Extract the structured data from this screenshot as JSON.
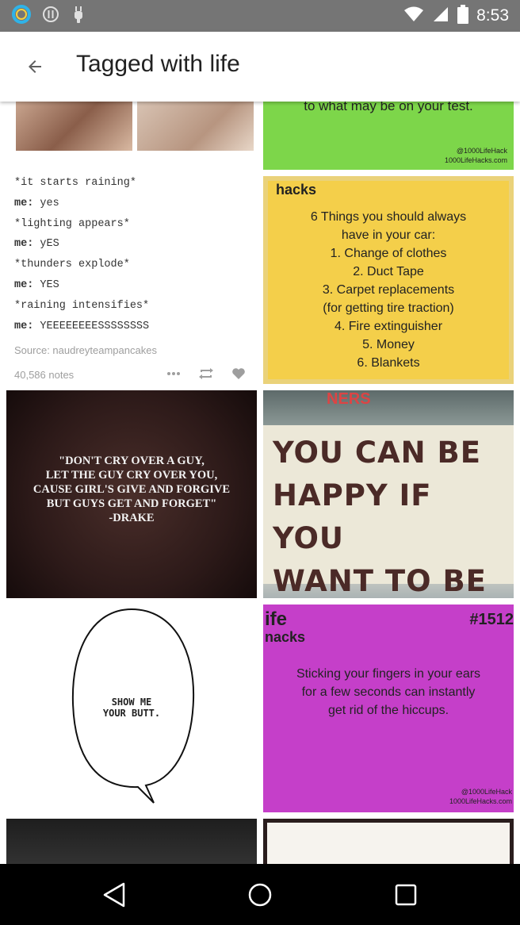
{
  "status_bar": {
    "time": "8:53",
    "left_icons": [
      "circle-app-icon",
      "alert-icon",
      "android-icon"
    ],
    "right_icons": [
      "wifi-icon",
      "signal-icon",
      "battery-icon"
    ]
  },
  "app_bar": {
    "title": "Tagged with life"
  },
  "tiles": {
    "green_lifehack": {
      "caption": "to what may be on your test.",
      "credit_1": "@1000LifeHack",
      "credit_2": "1000LifeHacks.com"
    },
    "text_post": {
      "lines": [
        {
          "prefix": "",
          "text": "*it starts raining*"
        },
        {
          "prefix": "me:",
          "text": " yes"
        },
        {
          "prefix": "",
          "text": "*lighting appears*"
        },
        {
          "prefix": "me:",
          "text": " yES"
        },
        {
          "prefix": "",
          "text": "*thunders explode*"
        },
        {
          "prefix": "me:",
          "text": " YES"
        },
        {
          "prefix": "",
          "text": "*raining intensifies*"
        },
        {
          "prefix": "me:",
          "text": " YEEEEEEEESSSSSSSS"
        }
      ],
      "source": "Source: naudreyteampancakes",
      "notes": "40,586 notes"
    },
    "yellow_lifehack": {
      "brand": "hacks",
      "heading_1": "6 Things you should always",
      "heading_2": "have in your car:",
      "items": [
        "1. Change of clothes",
        "2. Duct Tape",
        "3. Carpet replacements",
        "(for getting tire traction)",
        "4. Fire extinguisher",
        "5. Money",
        "6. Blankets"
      ]
    },
    "drake_quote": {
      "lines": [
        "\"DON'T CRY OVER A GUY,",
        "LET THE GUY CRY OVER YOU,",
        "CAUSE GIRL'S GIVE AND FORGIVE",
        "BUT GUYS GET AND FORGET\"",
        "-DRAKE"
      ]
    },
    "sign": {
      "top_text": "NERS",
      "lines": [
        "YOU CAN BE",
        "HAPPY IF YOU",
        "WANT TO BE"
      ]
    },
    "comic_bubble": {
      "line_1": "SHOW ME",
      "line_2": "YOUR BUTT."
    },
    "purple_lifehack": {
      "brand_1": "ife",
      "brand_2": "nacks",
      "number": "#1512",
      "lines": [
        "Sticking your fingers in your ears",
        "for a few seconds can instantly",
        "get rid of the hiccups."
      ],
      "credit_1": "@1000LifeHack",
      "credit_2": "1000LifeHacks.com"
    }
  },
  "nav_bar": {
    "buttons": [
      "back-nav-icon",
      "home-nav-icon",
      "recents-nav-icon"
    ]
  },
  "colors": {
    "status_bar": "#757575",
    "green_tile": "#7dd64a",
    "yellow_tile": "#f4cf4a",
    "purple_tile": "#c53fc9"
  }
}
